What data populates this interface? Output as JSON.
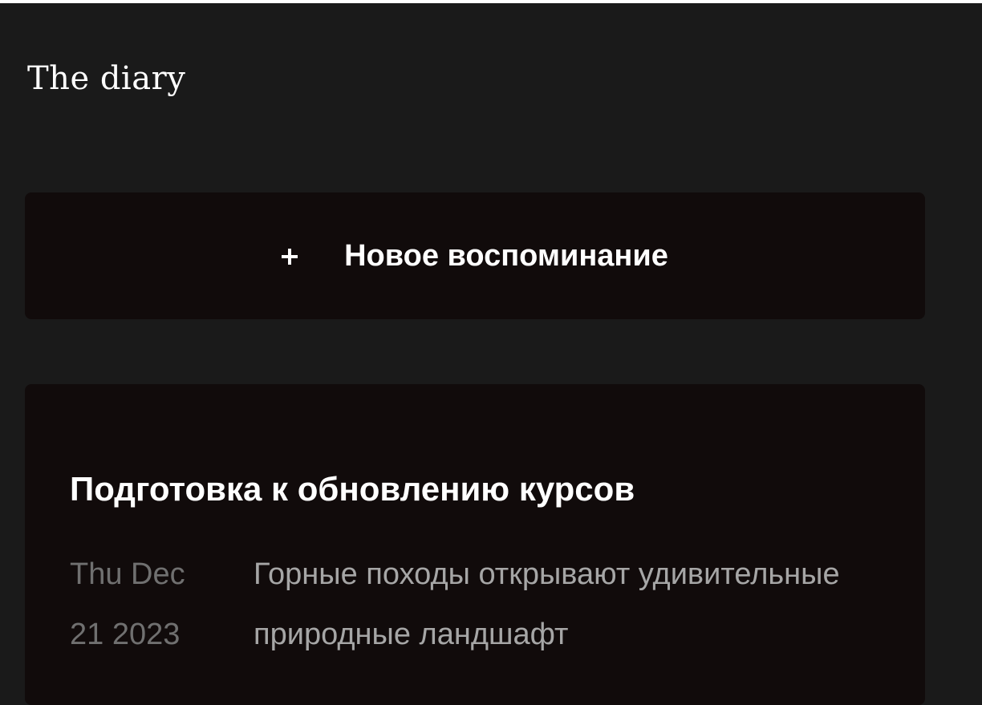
{
  "header": {
    "title": "The diary"
  },
  "new_memory_button": {
    "icon": "plus-icon",
    "label": "Новое воспоминание"
  },
  "memories": [
    {
      "title": "Подготовка к обновлению курсов",
      "date": "Thu Dec 21 2023",
      "text": "Горные походы открывают удивительные природные ландшафт"
    }
  ],
  "colors": {
    "background": "#1a1a1a",
    "card": "#110b0b",
    "title_text": "#ffffff",
    "date_text": "#707070",
    "body_text": "#a6a6a6"
  }
}
